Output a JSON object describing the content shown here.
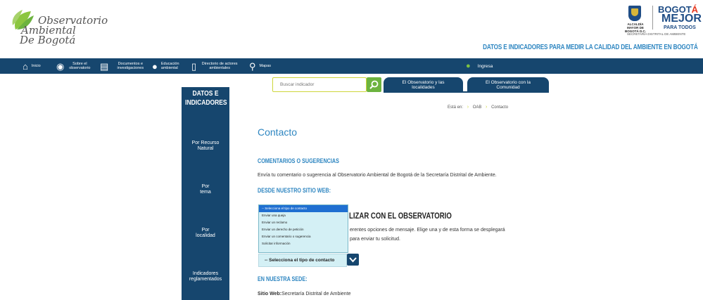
{
  "header": {
    "logo_lines": [
      "Observatorio",
      "Ambiental",
      "De Bogotá"
    ],
    "alcaldia": "ALCALDÍA MAYOR DE BOGOTÁ D.C.",
    "bogota_prefix": "BOGOT",
    "bogota_accent": "Á",
    "mejor": "MEJOR",
    "para_todos": "PARA TODOS",
    "secretaria": "SECRETARÍA DISTRITAL DE AMBIENTE",
    "tagline": "DATOS E INDICADORES PARA MEDIR LA CALIDAD DEL AMBIENTE EN BOGOTÁ"
  },
  "topnav": {
    "items": [
      {
        "label": "Inicio",
        "icon": "home-icon"
      },
      {
        "label": "Sobre el observatorio",
        "icon": "eye-icon"
      },
      {
        "label": "Documentos e investigaciones",
        "icon": "document-icon"
      },
      {
        "label": "Educación ambiental",
        "icon": "bulb-icon"
      },
      {
        "label": "Directorio de actores ambientales",
        "icon": "directory-icon"
      },
      {
        "label": "Mapas",
        "icon": "map-icon"
      }
    ],
    "login_label": "Ingresa",
    "login_icon": "user-icon"
  },
  "sidebar": {
    "title_line1": "DATOS E",
    "title_line2": "INDICADORES",
    "items": [
      {
        "label": "Por Recurso Natural"
      },
      {
        "label": "Por tema"
      },
      {
        "label": "Por localidad"
      },
      {
        "label": "Indicadores reglamentados"
      }
    ]
  },
  "search": {
    "placeholder": "Buscar indicador",
    "button_icon": "search-icon"
  },
  "tabs": [
    {
      "label": "El Observatorio y las localidades"
    },
    {
      "label": "El Observatorio con la Comunidad"
    }
  ],
  "breadcrumb": {
    "prefix": "Está en:",
    "items": [
      "OAB",
      "Contacto"
    ]
  },
  "content": {
    "title": "Contacto",
    "h_comentarios": "COMENTARIOS O SUGERENCIAS",
    "p_comentarios": "Envía tu comentario o sugerencia al Observatorio Ambiental de Bogotá de la Secretaría Distrital de Ambiente.",
    "h_sitio": "DESDE NUESTRO SITIO WEB:",
    "h_realizar_visible": "LIZAR CON EL OBSERVATORIO",
    "p_opciones_1": "erentes opciones de mensaje. Elige una y de esta forma se desplegará",
    "p_opciones_2": "para enviar tu solicitud.",
    "h_sede": "EN NUESTRA SEDE:",
    "sitio_web_label": "Sitio Web:",
    "sitio_web_value": "Secretaría Distrital de Ambiente"
  },
  "dropdown": {
    "options": [
      "-- Selecciona el tipo de contacto",
      "Enviar una queja",
      "Enviar un reclamo",
      "Enviar un derecho de petición",
      "Enviar un comentario o sugerencia",
      "Solicitar información"
    ],
    "selected_label": "-- Selecciona el tipo de contacto"
  },
  "colors": {
    "navy": "#16466e",
    "accent_blue": "#2e86c1",
    "green": "#6cb33f",
    "lime_border": "#cdd63a"
  }
}
